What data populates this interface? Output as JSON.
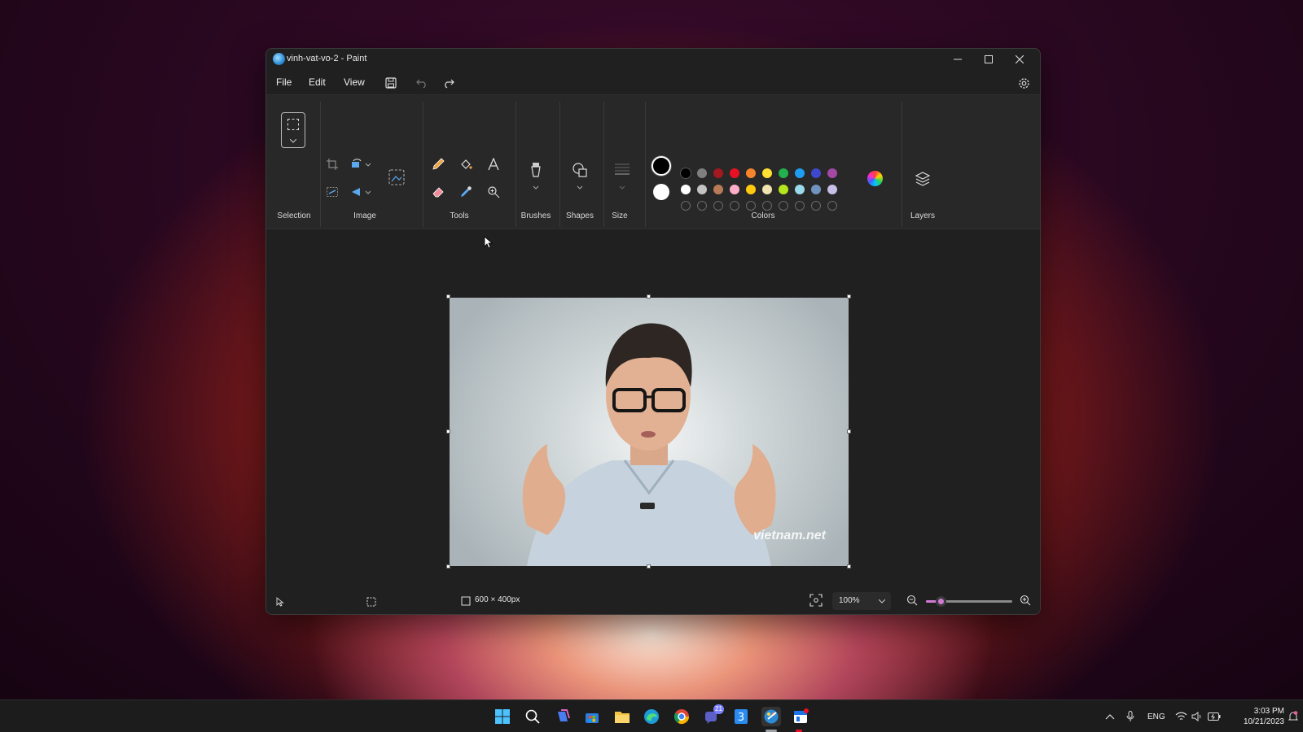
{
  "window": {
    "title": "vinh-vat-vo-2 - Paint",
    "menu": [
      "File",
      "Edit",
      "View"
    ]
  },
  "ribbon": {
    "groups": {
      "selection": "Selection",
      "image": "Image",
      "tools": "Tools",
      "brushes": "Brushes",
      "shapes": "Shapes",
      "size": "Size",
      "colors": "Colors",
      "layers": "Layers"
    },
    "colors": {
      "primary": "#000000",
      "secondary": "#ffffff",
      "row1": [
        "#000000",
        "#7f7f7f",
        "#a4181f",
        "#e81123",
        "#f7832a",
        "#ffe033",
        "#22b14c",
        "#1e9ef0",
        "#3f48cc",
        "#a349a4"
      ],
      "row2": [
        "#ffffff",
        "#c3c3c3",
        "#b97a57",
        "#ffaec9",
        "#ffc90e",
        "#efe4b0",
        "#b5e61d",
        "#99d9ea",
        "#7092be",
        "#c8bfe7"
      ],
      "row3_count": 10
    }
  },
  "canvas": {
    "watermark": "vietnam.net"
  },
  "status": {
    "dimensions": "600 × 400px",
    "zoom": "100%",
    "zoom_fraction": 0.17
  },
  "taskbar": {
    "chat_badge": "21",
    "language": "ENG",
    "time": "3:03 PM",
    "date": "10/21/2023"
  }
}
